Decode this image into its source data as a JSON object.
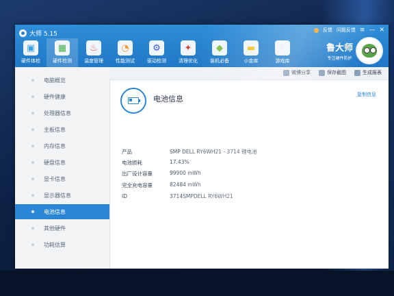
{
  "window": {
    "title": "大师 5.15",
    "tools": [
      "反馈",
      "问题反馈"
    ],
    "window_buttons": [
      "≡",
      "—",
      "✕"
    ]
  },
  "nav": [
    {
      "label": "硬件体检",
      "icon": "monitor-icon",
      "color": "#3aa0e8"
    },
    {
      "label": "硬件检测",
      "icon": "chip-icon",
      "color": "#4caf50",
      "active": true
    },
    {
      "label": "温度管理",
      "icon": "thermometer-icon",
      "color": "#e85a4f"
    },
    {
      "label": "性能测试",
      "icon": "speedometer-icon",
      "color": "#ff9a2e"
    },
    {
      "label": "驱动检测",
      "icon": "driver-icon",
      "color": "#3b5bd6"
    },
    {
      "label": "清理优化",
      "icon": "broom-icon",
      "color": "#d14b3a"
    },
    {
      "label": "装机必备",
      "icon": "cube-icon",
      "color": "#7cc242"
    },
    {
      "label": "小金库",
      "icon": "gold-icon",
      "color": "#f2c11a"
    },
    {
      "label": "游戏库",
      "icon": "gamepad-icon",
      "color": "#e8eef5"
    }
  ],
  "brand": {
    "name": "鲁大师",
    "slogan": "专注硬件防护"
  },
  "sidebar": [
    {
      "label": "电脑概览"
    },
    {
      "label": "硬件健康"
    },
    {
      "label": "处理器信息"
    },
    {
      "label": "主板信息"
    },
    {
      "label": "内存信息"
    },
    {
      "label": "硬盘信息"
    },
    {
      "label": "显卡信息"
    },
    {
      "label": "显示器信息"
    },
    {
      "label": "电池信息",
      "active": true
    },
    {
      "label": "其他硬件"
    },
    {
      "label": "功耗估算"
    }
  ],
  "actions": [
    {
      "label": "微博分享",
      "icon": "share-icon"
    },
    {
      "label": "保存截图",
      "icon": "camera-icon"
    },
    {
      "label": "生成报表",
      "icon": "report-icon"
    }
  ],
  "section": {
    "title": "电池信息",
    "copy_label": "复制信息"
  },
  "battery_info": [
    {
      "key": "产品",
      "value": "SMP DELL RY6WH21 - 3714 锂电池"
    },
    {
      "key": "电池损耗",
      "value": "17.43%"
    },
    {
      "key": "出厂设计容量",
      "value": "99900 mWh"
    },
    {
      "key": "完全充电容量",
      "value": "82484 mWh"
    },
    {
      "key": "ID",
      "value": "3714SMPDELL RY6WH21"
    }
  ]
}
